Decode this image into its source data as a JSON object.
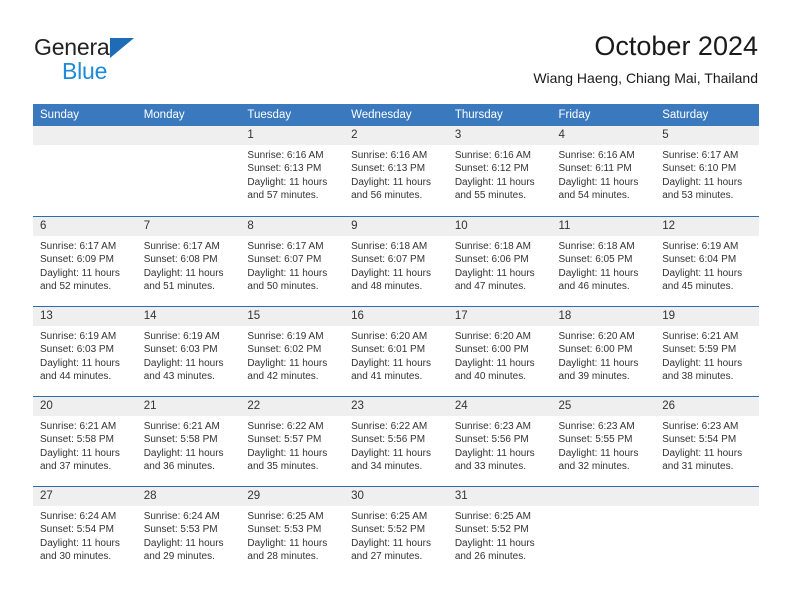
{
  "brand": {
    "name_dark": "General",
    "name_blue": "Blue",
    "color_dark": "#222222",
    "color_blue": "#1d8bd8",
    "triangle_color": "#1d6cb5"
  },
  "header": {
    "title": "October 2024",
    "subtitle": "Wiang Haeng, Chiang Mai, Thailand"
  },
  "theme": {
    "header_bg": "#3a79bd",
    "header_text": "#ffffff",
    "daynum_band_bg": "#efefef",
    "row_separator": "#2c6cb0",
    "cell_bg": "#ffffff",
    "text": "#333333"
  },
  "weekday_headers": [
    "Sunday",
    "Monday",
    "Tuesday",
    "Wednesday",
    "Thursday",
    "Friday",
    "Saturday"
  ],
  "weeks": [
    [
      {
        "day": "",
        "empty": true,
        "sunrise": "",
        "sunset": "",
        "daylight1": "",
        "daylight2": ""
      },
      {
        "day": "",
        "empty": true,
        "sunrise": "",
        "sunset": "",
        "daylight1": "",
        "daylight2": ""
      },
      {
        "day": "1",
        "sunrise": "Sunrise: 6:16 AM",
        "sunset": "Sunset: 6:13 PM",
        "daylight1": "Daylight: 11 hours",
        "daylight2": "and 57 minutes."
      },
      {
        "day": "2",
        "sunrise": "Sunrise: 6:16 AM",
        "sunset": "Sunset: 6:13 PM",
        "daylight1": "Daylight: 11 hours",
        "daylight2": "and 56 minutes."
      },
      {
        "day": "3",
        "sunrise": "Sunrise: 6:16 AM",
        "sunset": "Sunset: 6:12 PM",
        "daylight1": "Daylight: 11 hours",
        "daylight2": "and 55 minutes."
      },
      {
        "day": "4",
        "sunrise": "Sunrise: 6:16 AM",
        "sunset": "Sunset: 6:11 PM",
        "daylight1": "Daylight: 11 hours",
        "daylight2": "and 54 minutes."
      },
      {
        "day": "5",
        "sunrise": "Sunrise: 6:17 AM",
        "sunset": "Sunset: 6:10 PM",
        "daylight1": "Daylight: 11 hours",
        "daylight2": "and 53 minutes."
      }
    ],
    [
      {
        "day": "6",
        "sunrise": "Sunrise: 6:17 AM",
        "sunset": "Sunset: 6:09 PM",
        "daylight1": "Daylight: 11 hours",
        "daylight2": "and 52 minutes."
      },
      {
        "day": "7",
        "sunrise": "Sunrise: 6:17 AM",
        "sunset": "Sunset: 6:08 PM",
        "daylight1": "Daylight: 11 hours",
        "daylight2": "and 51 minutes."
      },
      {
        "day": "8",
        "sunrise": "Sunrise: 6:17 AM",
        "sunset": "Sunset: 6:07 PM",
        "daylight1": "Daylight: 11 hours",
        "daylight2": "and 50 minutes."
      },
      {
        "day": "9",
        "sunrise": "Sunrise: 6:18 AM",
        "sunset": "Sunset: 6:07 PM",
        "daylight1": "Daylight: 11 hours",
        "daylight2": "and 48 minutes."
      },
      {
        "day": "10",
        "sunrise": "Sunrise: 6:18 AM",
        "sunset": "Sunset: 6:06 PM",
        "daylight1": "Daylight: 11 hours",
        "daylight2": "and 47 minutes."
      },
      {
        "day": "11",
        "sunrise": "Sunrise: 6:18 AM",
        "sunset": "Sunset: 6:05 PM",
        "daylight1": "Daylight: 11 hours",
        "daylight2": "and 46 minutes."
      },
      {
        "day": "12",
        "sunrise": "Sunrise: 6:19 AM",
        "sunset": "Sunset: 6:04 PM",
        "daylight1": "Daylight: 11 hours",
        "daylight2": "and 45 minutes."
      }
    ],
    [
      {
        "day": "13",
        "sunrise": "Sunrise: 6:19 AM",
        "sunset": "Sunset: 6:03 PM",
        "daylight1": "Daylight: 11 hours",
        "daylight2": "and 44 minutes."
      },
      {
        "day": "14",
        "sunrise": "Sunrise: 6:19 AM",
        "sunset": "Sunset: 6:03 PM",
        "daylight1": "Daylight: 11 hours",
        "daylight2": "and 43 minutes."
      },
      {
        "day": "15",
        "sunrise": "Sunrise: 6:19 AM",
        "sunset": "Sunset: 6:02 PM",
        "daylight1": "Daylight: 11 hours",
        "daylight2": "and 42 minutes."
      },
      {
        "day": "16",
        "sunrise": "Sunrise: 6:20 AM",
        "sunset": "Sunset: 6:01 PM",
        "daylight1": "Daylight: 11 hours",
        "daylight2": "and 41 minutes."
      },
      {
        "day": "17",
        "sunrise": "Sunrise: 6:20 AM",
        "sunset": "Sunset: 6:00 PM",
        "daylight1": "Daylight: 11 hours",
        "daylight2": "and 40 minutes."
      },
      {
        "day": "18",
        "sunrise": "Sunrise: 6:20 AM",
        "sunset": "Sunset: 6:00 PM",
        "daylight1": "Daylight: 11 hours",
        "daylight2": "and 39 minutes."
      },
      {
        "day": "19",
        "sunrise": "Sunrise: 6:21 AM",
        "sunset": "Sunset: 5:59 PM",
        "daylight1": "Daylight: 11 hours",
        "daylight2": "and 38 minutes."
      }
    ],
    [
      {
        "day": "20",
        "sunrise": "Sunrise: 6:21 AM",
        "sunset": "Sunset: 5:58 PM",
        "daylight1": "Daylight: 11 hours",
        "daylight2": "and 37 minutes."
      },
      {
        "day": "21",
        "sunrise": "Sunrise: 6:21 AM",
        "sunset": "Sunset: 5:58 PM",
        "daylight1": "Daylight: 11 hours",
        "daylight2": "and 36 minutes."
      },
      {
        "day": "22",
        "sunrise": "Sunrise: 6:22 AM",
        "sunset": "Sunset: 5:57 PM",
        "daylight1": "Daylight: 11 hours",
        "daylight2": "and 35 minutes."
      },
      {
        "day": "23",
        "sunrise": "Sunrise: 6:22 AM",
        "sunset": "Sunset: 5:56 PM",
        "daylight1": "Daylight: 11 hours",
        "daylight2": "and 34 minutes."
      },
      {
        "day": "24",
        "sunrise": "Sunrise: 6:23 AM",
        "sunset": "Sunset: 5:56 PM",
        "daylight1": "Daylight: 11 hours",
        "daylight2": "and 33 minutes."
      },
      {
        "day": "25",
        "sunrise": "Sunrise: 6:23 AM",
        "sunset": "Sunset: 5:55 PM",
        "daylight1": "Daylight: 11 hours",
        "daylight2": "and 32 minutes."
      },
      {
        "day": "26",
        "sunrise": "Sunrise: 6:23 AM",
        "sunset": "Sunset: 5:54 PM",
        "daylight1": "Daylight: 11 hours",
        "daylight2": "and 31 minutes."
      }
    ],
    [
      {
        "day": "27",
        "sunrise": "Sunrise: 6:24 AM",
        "sunset": "Sunset: 5:54 PM",
        "daylight1": "Daylight: 11 hours",
        "daylight2": "and 30 minutes."
      },
      {
        "day": "28",
        "sunrise": "Sunrise: 6:24 AM",
        "sunset": "Sunset: 5:53 PM",
        "daylight1": "Daylight: 11 hours",
        "daylight2": "and 29 minutes."
      },
      {
        "day": "29",
        "sunrise": "Sunrise: 6:25 AM",
        "sunset": "Sunset: 5:53 PM",
        "daylight1": "Daylight: 11 hours",
        "daylight2": "and 28 minutes."
      },
      {
        "day": "30",
        "sunrise": "Sunrise: 6:25 AM",
        "sunset": "Sunset: 5:52 PM",
        "daylight1": "Daylight: 11 hours",
        "daylight2": "and 27 minutes."
      },
      {
        "day": "31",
        "sunrise": "Sunrise: 6:25 AM",
        "sunset": "Sunset: 5:52 PM",
        "daylight1": "Daylight: 11 hours",
        "daylight2": "and 26 minutes."
      },
      {
        "day": "",
        "empty": true,
        "sunrise": "",
        "sunset": "",
        "daylight1": "",
        "daylight2": ""
      },
      {
        "day": "",
        "empty": true,
        "sunrise": "",
        "sunset": "",
        "daylight1": "",
        "daylight2": ""
      }
    ]
  ]
}
